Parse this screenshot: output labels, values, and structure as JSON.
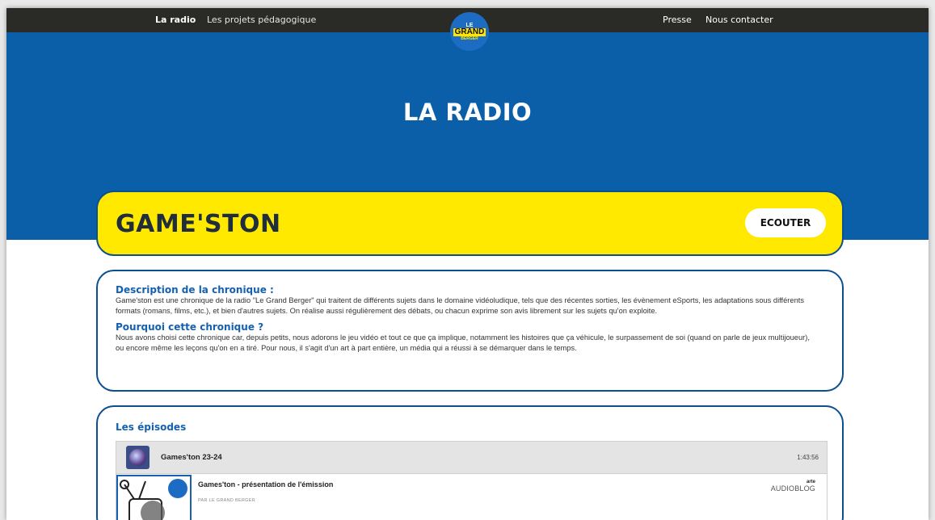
{
  "nav": {
    "left": [
      "La radio",
      "Les projets pédagogique"
    ],
    "right": [
      "Presse",
      "Nous contacter"
    ],
    "logo": {
      "line1": "LE",
      "line2": "GRAND",
      "line3": "BERGER"
    }
  },
  "hero": {
    "title": "LA RADIO"
  },
  "show": {
    "title": "GAME'STON",
    "listen_label": "ECOUTER"
  },
  "description": {
    "heading1": "Description de la chronique :",
    "text1": "Game'ston est une chronique de la radio \"Le Grand Berger\" qui traitent de différents sujets dans le domaine vidéoludique, tels que des récentes sorties, les évènement eSports, les adaptations sous différents formats (romans, films, etc.), et bien d'autres sujets. On réalise aussi régulièrement des débats, ou chacun exprime son avis librement sur les sujets qu'on exploite.",
    "heading2": "Pourquoi cette chronique ?",
    "text2": "Nous avons choisi cette chronique car, depuis petits, nous adorons le jeu vidéo et tout ce que ça implique, notamment les histoires que ça véhicule, le surpassement de soi (quand on parle de jeux multijoueur), ou encore même les leçons qu'on en a tiré. Pour nous, il s'agit d'un art à part entière, un média qui a réussi à se démarquer dans le temps."
  },
  "episodes": {
    "heading": "Les épisodes",
    "playlist_title": "Games'ton 23-24",
    "playlist_duration": "1:43:56",
    "items": [
      {
        "title": "Games'ton - présentation de l'émission",
        "byline": "PAR LE GRAND BERGER",
        "brand_top": "arte",
        "brand": "AUDIOBLOG"
      }
    ]
  },
  "colors": {
    "nav_bg": "#2a2a26",
    "hero_blue": "#0a5fa8",
    "accent_yellow": "#ffe900",
    "heading_blue": "#1560b0",
    "border_blue": "#0a4f8f"
  }
}
